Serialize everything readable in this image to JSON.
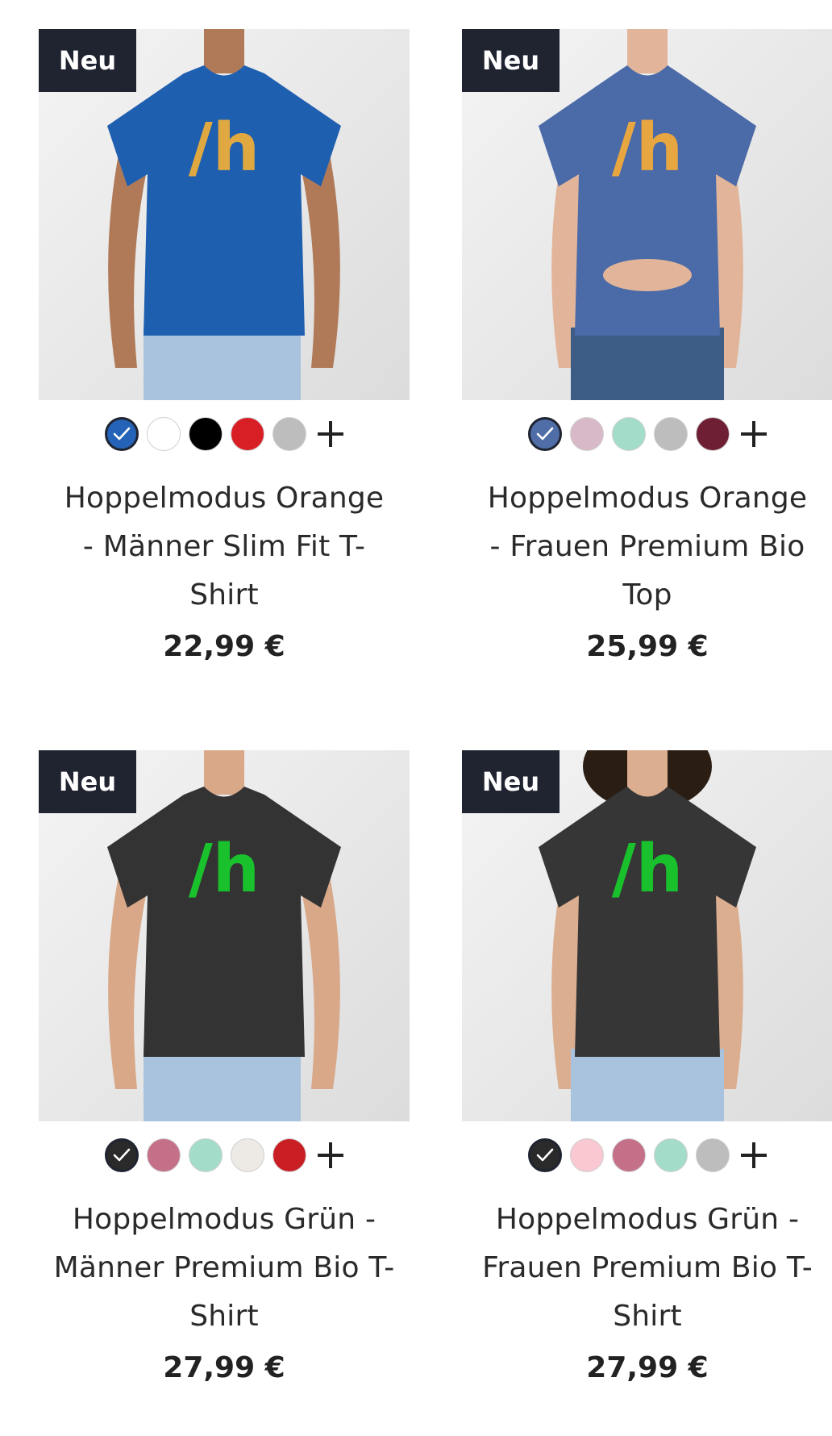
{
  "products": [
    {
      "badge": "Neu",
      "title_lines": [
        "Hoppelmodus Orange",
        "- Männer Slim Fit T-",
        "Shirt"
      ],
      "price": "22,99 €",
      "shirt_color": "#1f5fb0",
      "print_color": "#e0a840",
      "pants_color": "#a9c3de",
      "skin_color": "#b07a58",
      "fit": "male",
      "swatches": [
        "#2563b8",
        "#ffffff",
        "#000000",
        "#d81f26",
        "#bdbdbd"
      ],
      "selected_swatch": 0
    },
    {
      "badge": "Neu",
      "title_lines": [
        "Hoppelmodus Orange",
        "- Frauen Premium Bio",
        "Top"
      ],
      "price": "25,99 €",
      "shirt_color": "#4a6aa8",
      "print_color": "#e8a640",
      "pants_color": "#3e5d86",
      "skin_color": "#e2b59a",
      "fit": "female",
      "swatches": [
        "#4f6ea8",
        "#d8b9c8",
        "#a3dcc9",
        "#bdbdbd",
        "#6e1f33"
      ],
      "selected_swatch": 0
    },
    {
      "badge": "Neu",
      "title_lines": [
        "Hoppelmodus Grün -",
        "Männer Premium Bio T-",
        "Shirt"
      ],
      "price": "27,99 €",
      "shirt_color": "#333333",
      "print_color": "#19c22c",
      "pants_color": "#a9c3de",
      "skin_color": "#d8a888",
      "fit": "male",
      "swatches": [
        "#2a2a2a",
        "#c47088",
        "#a3dcc9",
        "#ede9e4",
        "#c81e24"
      ],
      "selected_swatch": 0
    },
    {
      "badge": "Neu",
      "title_lines": [
        "Hoppelmodus Grün -",
        "Frauen Premium Bio T-",
        "Shirt"
      ],
      "price": "27,99 €",
      "shirt_color": "#363636",
      "print_color": "#19c22c",
      "pants_color": "#a9c3de",
      "skin_color": "#dcae90",
      "fit": "female",
      "swatches": [
        "#2a2a2a",
        "#f9c8d0",
        "#c47088",
        "#a3dcc9",
        "#bdbdbd"
      ],
      "selected_swatch": 0
    }
  ],
  "print_text": "/h",
  "more_colors_icon": "plus-icon",
  "selected_icon": "check-icon"
}
